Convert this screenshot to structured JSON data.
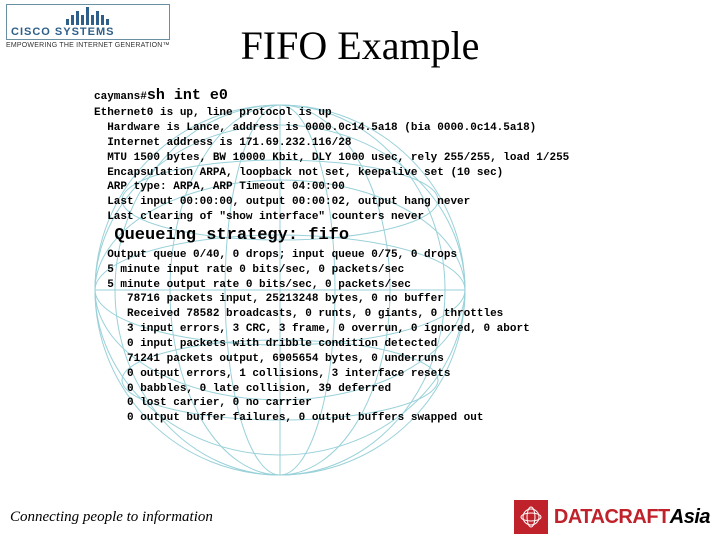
{
  "logo": {
    "brand": "CISCO SYSTEMS",
    "tagline": "EMPOWERING THE INTERNET GENERATION™"
  },
  "title": "FIFO Example",
  "terminal": {
    "prompt": "caymans#",
    "command": "sh int e0",
    "l01": "Ethernet0 is up, line protocol is up",
    "l02": "  Hardware is Lance, address is 0000.0c14.5a18 (bia 0000.0c14.5a18)",
    "l03": "  Internet address is 171.69.232.116/28",
    "l04": "  MTU 1500 bytes, BW 10000 Kbit, DLY 1000 usec, rely 255/255, load 1/255",
    "l05": "  Encapsulation ARPA, loopback not set, keepalive set (10 sec)",
    "l06": "  ARP type: ARPA, ARP Timeout 04:00:00",
    "l07": "  Last input 00:00:00, output 00:00:02, output hang never",
    "l08": "  Last clearing of \"show interface\" counters never",
    "queue_line": "  Queueing strategy: fifo",
    "l09": "  Output queue 0/40, 0 drops; input queue 0/75, 0 drops",
    "l10": "  5 minute input rate 0 bits/sec, 0 packets/sec",
    "l11": "  5 minute output rate 0 bits/sec, 0 packets/sec",
    "l12": "     78716 packets input, 25213248 bytes, 0 no buffer",
    "l13": "     Received 78582 broadcasts, 0 runts, 0 giants, 0 throttles",
    "l14": "     3 input errors, 3 CRC, 3 frame, 0 overrun, 0 ignored, 0 abort",
    "l15": "     0 input packets with dribble condition detected",
    "l16": "     71241 packets output, 6905654 bytes, 0 underruns",
    "l17": "     0 output errors, 1 collisions, 3 interface resets",
    "l18": "     0 babbles, 0 late collision, 39 deferred",
    "l19": "     0 lost carrier, 0 no carrier",
    "l20": "     0 output buffer failures, 0 output buffers swapped out"
  },
  "footer": {
    "left": "Connecting people to information",
    "brand": "DATACRAFT",
    "suffix": "Asia"
  }
}
